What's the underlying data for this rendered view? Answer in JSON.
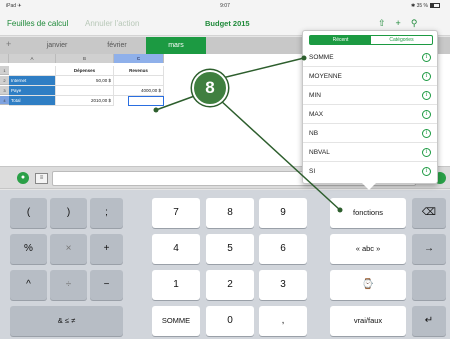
{
  "statusbar": {
    "device": "iPad ✈",
    "time": "9:07",
    "battery": "✱ 35 %"
  },
  "toolbar": {
    "docs_label": "Feuilles de calcul",
    "undo_label": "Annuler l'action",
    "title": "Budget 2015",
    "icon_names": [
      "share-icon",
      "add-icon",
      "tools-icon",
      "help-icon"
    ]
  },
  "sheet_tabs": [
    {
      "label": "+"
    },
    {
      "label": "janvier"
    },
    {
      "label": "février"
    },
    {
      "label": "mars",
      "active": true
    }
  ],
  "grid": {
    "col_heads": [
      "A",
      "B",
      "C"
    ],
    "row_heads": [
      "1",
      "2",
      "3",
      "4"
    ],
    "rows": [
      {
        "a": "",
        "b": "Dépenses",
        "c": "Revenus"
      },
      {
        "a": "Internet",
        "b": "50,00 $",
        "c": ""
      },
      {
        "a": "Paye",
        "b": "",
        "c": "4000,00 $"
      },
      {
        "a": "Total",
        "b": "2010,00 $",
        "c": ""
      }
    ]
  },
  "formula_bar": {
    "menu_label": "≡",
    "value": ""
  },
  "popover": {
    "segments": [
      "Récent",
      "Catégories"
    ],
    "active_segment": "Récent",
    "functions": [
      "SOMME",
      "MOYENNE",
      "MIN",
      "MAX",
      "NB",
      "NBVAL",
      "SI"
    ],
    "info_glyph": "i"
  },
  "callout": {
    "number": "8"
  },
  "keyboard": {
    "rows": [
      [
        "(",
        ")",
        ";",
        "7",
        "8",
        "9",
        "fonctions",
        "⌫"
      ],
      [
        "%",
        "×",
        "+",
        "4",
        "5",
        "6",
        "« abc »",
        "→"
      ],
      [
        "^",
        "÷",
        "−",
        "1",
        "2",
        "3",
        "⌚",
        ""
      ],
      [
        "& ≤ ≠",
        "SOMME",
        "0",
        ",",
        "vrai/faux",
        "↵"
      ]
    ]
  },
  "colors": {
    "accent": "#1c9a42",
    "cell_blue": "#2f7ec4",
    "callout_badge": "#3f7f3f"
  }
}
